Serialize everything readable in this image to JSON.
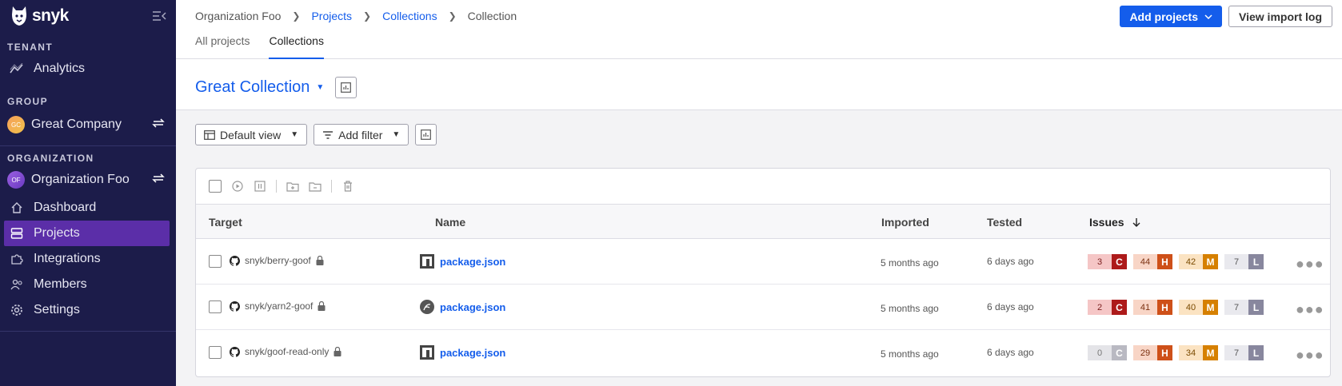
{
  "sidebar": {
    "brand": "snyk",
    "tenant_label": "TENANT",
    "analytics": "Analytics",
    "group_label": "GROUP",
    "group_avatar": "GC",
    "group_name": "Great Company",
    "org_label": "ORGANIZATION",
    "org_avatar": "OF",
    "org_name": "Organization Foo",
    "items": [
      {
        "label": "Dashboard",
        "icon": "home-icon"
      },
      {
        "label": "Projects",
        "icon": "projects-icon"
      },
      {
        "label": "Integrations",
        "icon": "puzzle-icon"
      },
      {
        "label": "Members",
        "icon": "members-icon"
      },
      {
        "label": "Settings",
        "icon": "gear-icon"
      }
    ]
  },
  "header": {
    "breadcrumb": [
      "Organization Foo",
      "Projects",
      "Collections",
      "Collection"
    ],
    "add_projects": "Add projects",
    "view_import_log": "View import log",
    "tabs": [
      "All projects",
      "Collections"
    ]
  },
  "collection": {
    "title": "Great Collection"
  },
  "filters": {
    "default_view": "Default view",
    "add_filter": "Add filter"
  },
  "table": {
    "columns": [
      "Target",
      "Name",
      "Imported",
      "Tested",
      "Issues"
    ],
    "rows": [
      {
        "target": "snyk/berry-goof",
        "name": "package.json",
        "imported": "5 months ago",
        "tested": "6 days ago",
        "c": "3",
        "h": "44",
        "m": "42",
        "l": "7",
        "c_zero": false
      },
      {
        "target": "snyk/yarn2-goof",
        "name": "package.json",
        "imported": "5 months ago",
        "tested": "6 days ago",
        "c": "2",
        "h": "41",
        "m": "40",
        "l": "7",
        "c_zero": false
      },
      {
        "target": "snyk/goof-read-only",
        "name": "package.json",
        "imported": "5 months ago",
        "tested": "6 days ago",
        "c": "0",
        "h": "29",
        "m": "34",
        "l": "7",
        "c_zero": true
      }
    ],
    "severity_letters": {
      "c": "C",
      "h": "H",
      "m": "M",
      "l": "L"
    }
  },
  "colors": {
    "sidebar_bg": "#1c1c4a",
    "accent": "#145deb",
    "active_item": "#5b2ea8",
    "critical": "#ad1a1a",
    "high": "#ce5019",
    "medium": "#d68000",
    "low": "#88879e"
  }
}
